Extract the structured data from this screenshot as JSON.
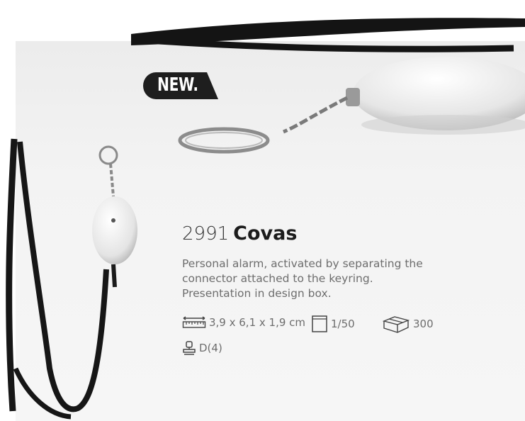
{
  "badge": {
    "label": "NEW."
  },
  "product": {
    "code": "2991",
    "name": "Covas",
    "description_lines": [
      "Personal alarm, activated by separating the",
      "connector attached to the keyring.",
      "Presentation in design box."
    ]
  },
  "specs": {
    "dimensions": "3,9 x 6,1 x 1,9 cm",
    "packing": "1/50",
    "box_quantity": "300",
    "print": "D(4)"
  },
  "icons": [
    "ruler-icon",
    "box-packing-icon",
    "carton-icon",
    "stamp-icon"
  ],
  "colors": {
    "badge": "#1e1e1e",
    "text": "#6d6d6d",
    "title": "#1c1c1c"
  }
}
